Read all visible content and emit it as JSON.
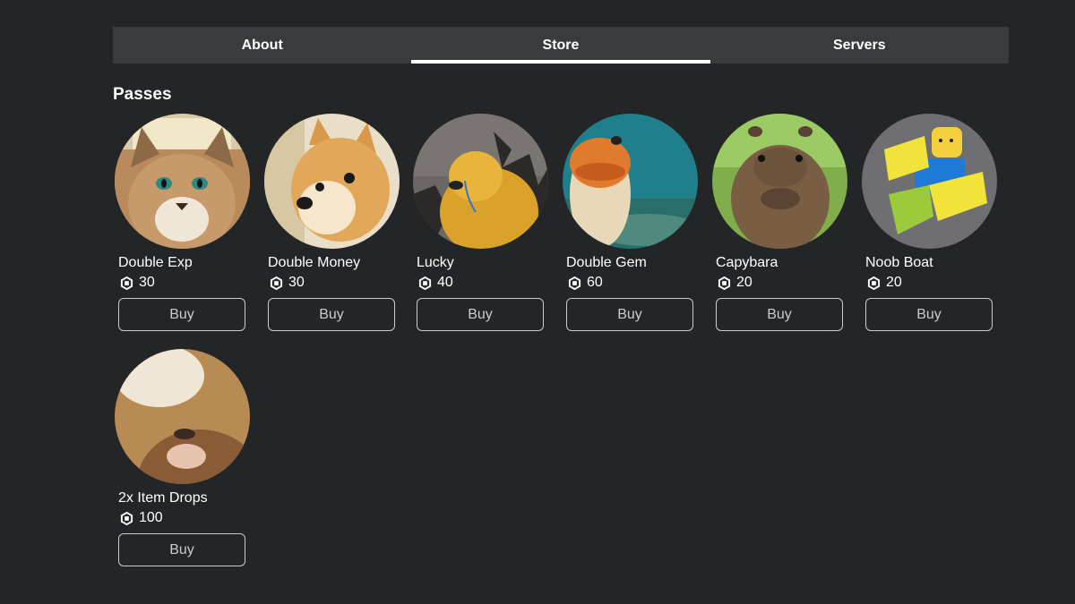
{
  "tabs": [
    {
      "label": "About",
      "active": false
    },
    {
      "label": "Store",
      "active": true
    },
    {
      "label": "Servers",
      "active": false
    }
  ],
  "section_title": "Passes",
  "currency_icon": "robux-icon",
  "passes": [
    {
      "name": "Double Exp",
      "price": "30",
      "buy_label": "Buy",
      "image": "caracal-cat-image"
    },
    {
      "name": "Double Money",
      "price": "30",
      "buy_label": "Buy",
      "image": "doge-image"
    },
    {
      "name": "Lucky",
      "price": "40",
      "buy_label": "Buy",
      "image": "crying-cheems-image"
    },
    {
      "name": "Double Gem",
      "price": "60",
      "buy_label": "Buy",
      "image": "fish-image"
    },
    {
      "name": "Capybara",
      "price": "20",
      "buy_label": "Buy",
      "image": "capybara-image"
    },
    {
      "name": "Noob Boat",
      "price": "20",
      "buy_label": "Buy",
      "image": "roblox-noob-image"
    },
    {
      "name": "2x Item Drops",
      "price": "100",
      "buy_label": "Buy",
      "image": "hamster-image"
    }
  ]
}
